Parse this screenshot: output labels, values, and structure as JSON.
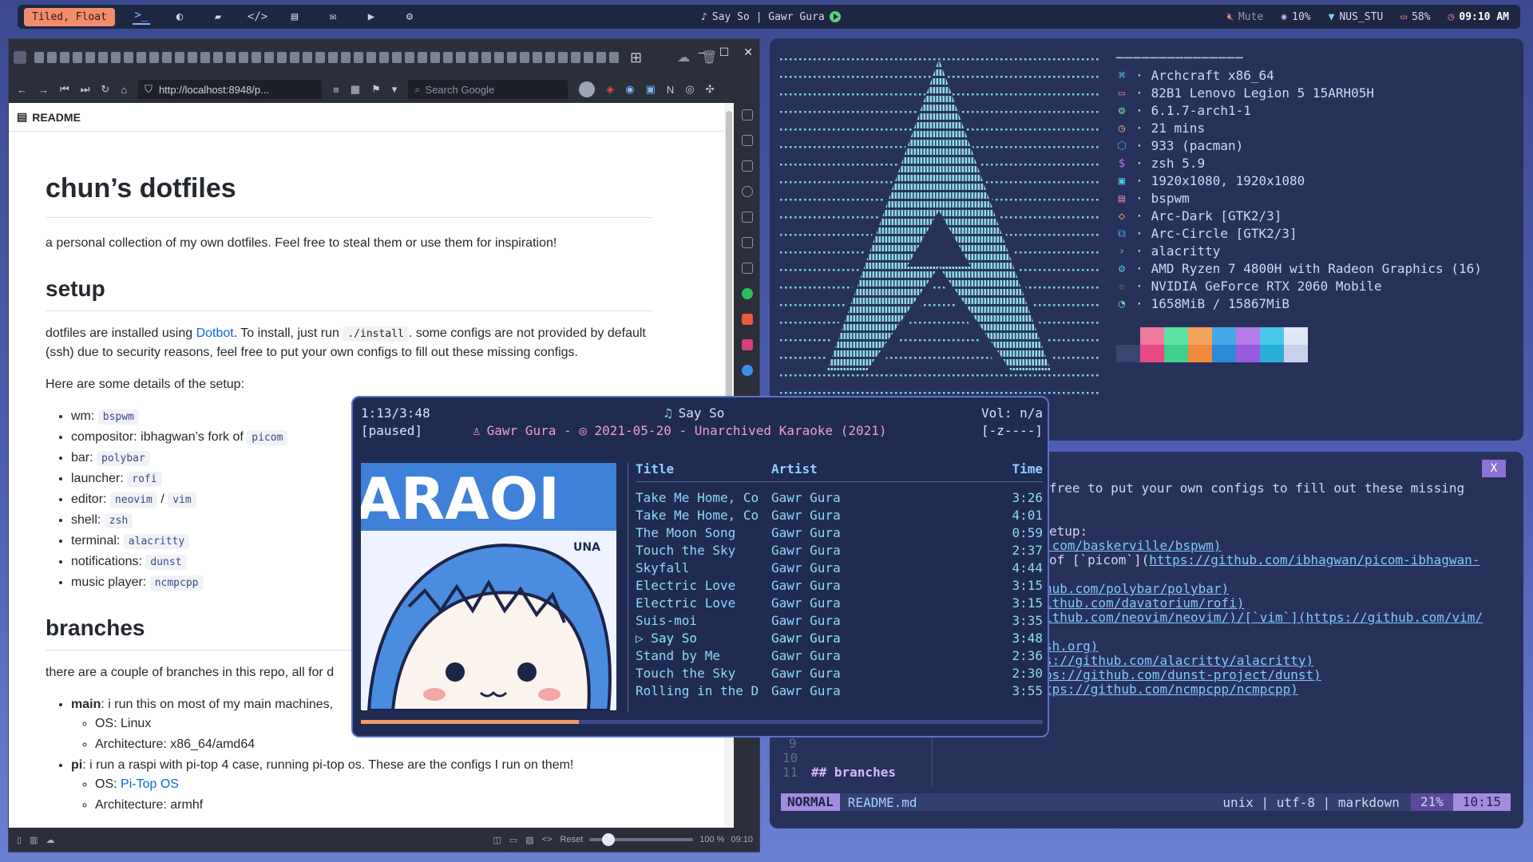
{
  "topbar": {
    "layout": "Tiled, Float",
    "workspaces": [
      "terminal",
      "firefox",
      "files",
      "code",
      "notes",
      "chat",
      "media",
      "settings"
    ],
    "now_playing": "Say So | Gawr Gura",
    "mute_label": "Mute",
    "brightness": "10%",
    "wifi": "NUS_STU",
    "battery": "58%",
    "clock": "09:10 AM"
  },
  "browser": {
    "url": "http://localhost:8948/p...",
    "search_placeholder": "Search Google",
    "readme_label": "README",
    "zoom_reset": "Reset",
    "zoom": "100 %",
    "status_time": "09:10"
  },
  "doc": {
    "title": "chun’s dotfiles",
    "intro": "a personal collection of my own dotfiles. Feel free to steal them or use them for inspiration!",
    "setup_heading": "setup",
    "setup_p1_a": "dotfiles are installed using ",
    "setup_p1_link": "Dotbot",
    "setup_p1_b": ". To install, just run ",
    "setup_p1_code": "./install",
    "setup_p1_c": ". some configs are not provided by default (ssh) due to security reasons, feel free to put your own configs to fill out these missing configs.",
    "setup_p2": "Here are some details of the setup:",
    "wm": "wm: ",
    "wm_code": "bspwm",
    "compositor": "compositor: ibhagwan’s fork of ",
    "compositor_code": "picom",
    "bar": "bar: ",
    "bar_code": "polybar",
    "launcher": "launcher: ",
    "launcher_code": "rofi",
    "editor": "editor: ",
    "editor_code1": "neovim",
    "editor_sep": " / ",
    "editor_code2": "vim",
    "shell": "shell: ",
    "shell_code": "zsh",
    "terminal": "terminal: ",
    "terminal_code": "alacritty",
    "notifications": "notifications: ",
    "notifications_code": "dunst",
    "music": "music player: ",
    "music_code": "ncmpcpp",
    "branches_heading": "branches",
    "branches_p": "there are a couple of branches in this repo, all for d",
    "main_label": "main",
    "main_text": ": i run this on most of my main machines,",
    "main_os": "OS: Linux",
    "main_arch": "Architecture: x86_64/amd64",
    "pi_label": "pi",
    "pi_text": ": i run a raspi with pi-top 4 case, running pi-top os. These are the configs I run on them!",
    "pi_os_label": "OS: ",
    "pi_os_link": "Pi-Top OS",
    "pi_arch": "Architecture: armhf"
  },
  "neofetch": {
    "separator": "───────────────",
    "rows": [
      {
        "icon": "⌘",
        "value": "Archcraft x86_64"
      },
      {
        "icon": "▭",
        "value": "82B1 Lenovo Legion 5 15ARH05H"
      },
      {
        "icon": "⚙",
        "value": "6.1.7-arch1-1"
      },
      {
        "icon": "◷",
        "value": "21 mins"
      },
      {
        "icon": "⬡",
        "value": "933 (pacman)"
      },
      {
        "icon": "$",
        "value": "zsh 5.9"
      },
      {
        "icon": "▣",
        "value": "1920x1080, 1920x1080"
      },
      {
        "icon": "▤",
        "value": "bspwm"
      },
      {
        "icon": "◇",
        "value": "Arc-Dark [GTK2/3]"
      },
      {
        "icon": "⧉",
        "value": "Arc-Circle [GTK2/3]"
      },
      {
        "icon": "›",
        "value": "alacritty"
      },
      {
        "icon": "⚙",
        "value": "AMD Ryzen 7 4800H with Radeon Graphics (16)"
      },
      {
        "icon": "☆",
        "value": "NVIDIA GeForce RTX 2060 Mobile"
      },
      {
        "icon": "◔",
        "value": "1658MiB / 15867MiB"
      }
    ],
    "palette_top": [
      "#27325a",
      "#f07aa0",
      "#5ee2a6",
      "#f5a35c",
      "#45a8e8",
      "#b47ae6",
      "#48c8e8",
      "#dfe6f5"
    ],
    "palette_bottom": [
      "#3a4670",
      "#e84a86",
      "#3ed08c",
      "#f08a3c",
      "#2a8ad8",
      "#9a5ae0",
      "#2ab0d8",
      "#c8d2e8"
    ]
  },
  "vim": {
    "close": "X",
    "lines": [
      {
        "text": "free to put your own configs to fill out these missing",
        "link": ""
      },
      {
        "text": "",
        "link": ""
      },
      {
        "text": "etup:",
        "link": ""
      },
      {
        "text": "",
        "link": ".com/baskerville/bspwm)"
      },
      {
        "text": "of [`picom`](",
        "link": "https://github.com/ibhagwan/picom-ibhagwan-"
      },
      {
        "text": "",
        "link": ""
      },
      {
        "text": "",
        "link": "hub.com/polybar/polybar)"
      },
      {
        "text": "",
        "link": "ithub.com/davatorium/rofi)"
      },
      {
        "text": "",
        "link": "ithub.com/neovim/neovim/)/[`vim`](https://github.com/vim/"
      },
      {
        "text": "",
        "link": ""
      },
      {
        "text": "",
        "link": "sh.org)"
      },
      {
        "text": "",
        "link": "s://github.com/alacritty/alacritty)"
      },
      {
        "text": "",
        "link": "ps://github.com/dunst-project/dunst)"
      },
      {
        "text": "",
        "link": "tps://github.com/ncmpcpp/ncmpcpp)"
      }
    ],
    "num_9": "9",
    "num_10": "10",
    "num_11": "11",
    "line_11": "## branches",
    "mode": "NORMAL",
    "file": "README.md",
    "format": "unix | utf-8 | markdown",
    "percent": "21%",
    "position": "10:15"
  },
  "ncmpcpp": {
    "time": "1:13/3:48",
    "state": "[paused]",
    "title": "Say So",
    "meta": "Gawr Gura - ◎ 2021-05-20 - Unarchived Karaoke (2021)",
    "volume": "Vol: n/a",
    "flags": "[-z----]",
    "progress": 0.32,
    "columns": {
      "title": "Title",
      "artist": "Artist",
      "time": "Time"
    },
    "tracks": [
      {
        "title": "Take Me Home, Co",
        "artist": "Gawr Gura",
        "time": "3:26"
      },
      {
        "title": "Take Me Home, Co",
        "artist": "Gawr Gura",
        "time": "4:01"
      },
      {
        "title": "The Moon Song",
        "artist": "Gawr Gura",
        "time": "0:59"
      },
      {
        "title": "Touch the Sky",
        "artist": "Gawr Gura",
        "time": "2:37"
      },
      {
        "title": "Skyfall",
        "artist": "Gawr Gura",
        "time": "4:44"
      },
      {
        "title": "Electric Love",
        "artist": "Gawr Gura",
        "time": "3:15"
      },
      {
        "title": "Electric Love",
        "artist": "Gawr Gura",
        "time": "3:15"
      },
      {
        "title": "Suis-moi",
        "artist": "Gawr Gura",
        "time": "3:35"
      },
      {
        "title": "▷ Say So",
        "artist": " Gawr Gura",
        "time": "3:48"
      },
      {
        "title": "Stand by Me",
        "artist": "Gawr Gura",
        "time": "2:36"
      },
      {
        "title": "Touch the Sky",
        "artist": "Gawr Gura",
        "time": "2:30"
      },
      {
        "title": "Rolling in the D",
        "artist": "Gawr Gura",
        "time": "3:55"
      }
    ],
    "cover_text": "ARAOI",
    "cover_sub": "UNA"
  }
}
